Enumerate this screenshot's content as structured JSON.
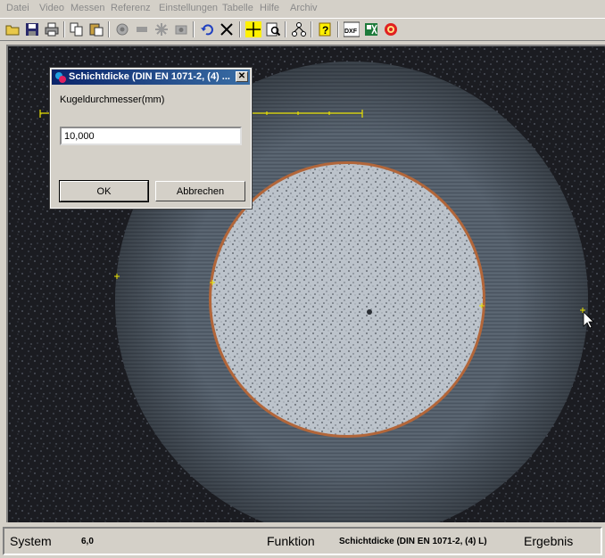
{
  "menu": [
    "Datei",
    "Video",
    "Messen",
    "Referenz",
    "Einstellungen",
    "Tabelle",
    "Hilfe",
    "Archiv"
  ],
  "toolbar": {
    "icons": [
      "open-folder-icon",
      "save-icon",
      "print-icon",
      "copy-icon",
      "paste-icon",
      "camera-icon",
      "capture-icon",
      "freeze-icon",
      "video-icon",
      "undo-icon",
      "delete-icon",
      "crosshair-icon",
      "preview-icon",
      "network-icon",
      "help-icon",
      "dxf-icon",
      "excel-icon",
      "settings-icon"
    ],
    "dxf_label": "DXF"
  },
  "dialog": {
    "title": "Schichtdicke (DIN EN 1071-2, (4) ...",
    "close_label": "✕",
    "field_label": "Kugeldurchmesser(mm)",
    "field_value": "10,000",
    "ok_label": "OK",
    "cancel_label": "Abbrechen"
  },
  "statusbar": {
    "system_label": "System",
    "system_value": "6,0",
    "function_label": "Funktion",
    "function_value": "Schichtdicke (DIN EN 1071-2, (4) L)",
    "result_label": "Ergebnis"
  },
  "colors": {
    "title_bar": "#0a246a",
    "measure_line": "#e8e000",
    "background_dark": "#1c1d22",
    "ring_gray": "#4f5965",
    "inner_disk": "#b8bfc6"
  }
}
